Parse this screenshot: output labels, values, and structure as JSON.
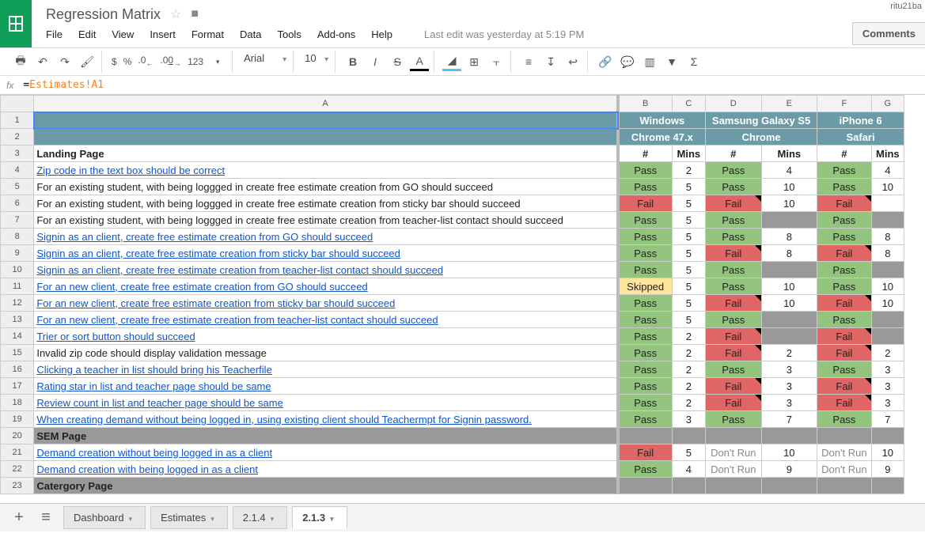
{
  "doc": {
    "title": "Regression Matrix",
    "user": "ritu21ba",
    "last_edit": "Last edit was yesterday at 5:19 PM",
    "comments_btn": "Comments"
  },
  "menubar": [
    "File",
    "Edit",
    "View",
    "Insert",
    "Format",
    "Data",
    "Tools",
    "Add-ons",
    "Help"
  ],
  "toolbar": {
    "currency": "$",
    "percent": "%",
    "dec_dec": ".0←",
    "dec_inc": ".00→",
    "more_fmt": "123",
    "font": "Arial",
    "size": "10"
  },
  "formula": {
    "eq": "=",
    "ref": "Estimates!A1"
  },
  "columns": [
    "",
    "A",
    "B",
    "C",
    "D",
    "E",
    "F",
    "G"
  ],
  "header1": {
    "B": "Windows",
    "D": "Samsung Galaxy S5",
    "F": "iPhone 6"
  },
  "header2": {
    "B": "Chrome 47.x",
    "D": "Chrome",
    "F": "Safari"
  },
  "rows": [
    {
      "n": 1
    },
    {
      "n": 2
    },
    {
      "n": 3,
      "a": "Landing Page",
      "bold": true,
      "b": "#",
      "c": "Mins",
      "d": "#",
      "e": "Mins",
      "f": "#",
      "g": "Mins",
      "hdr": true
    },
    {
      "n": 4,
      "a": "Zip code in the text box should be correct",
      "link": true,
      "b": "Pass",
      "c": "2",
      "d": "Pass",
      "e": "4",
      "f": "Pass",
      "g": "4"
    },
    {
      "n": 5,
      "a": "For an existing student, with being loggged in create free estimate creation from GO should succeed",
      "b": "Pass",
      "c": "5",
      "d": "Pass",
      "e": "10",
      "f": "Pass",
      "g": "10"
    },
    {
      "n": 6,
      "a": "For an existing student, with being loggged in create free estimate creation from sticky bar should succeed",
      "b": "Fail",
      "c": "5",
      "d": "Fail",
      "e": "10",
      "f": "Fail",
      "g": "",
      "note_d": true,
      "note_f": true
    },
    {
      "n": 7,
      "a": "For an existing student, with being loggged in create free estimate creation from teacher-list contact should succeed",
      "b": "Pass",
      "c": "5",
      "d": "Pass",
      "e": "",
      "f": "Pass",
      "g": "",
      "egray": true,
      "ggray": true
    },
    {
      "n": 8,
      "a": "Signin as an client, create free estimate creation from GO should succeed",
      "link": true,
      "b": "Pass",
      "c": "5",
      "d": "Pass",
      "e": "8",
      "f": "Pass",
      "g": "8"
    },
    {
      "n": 9,
      "a": "Signin as an client, create free estimate creation from sticky bar should succeed",
      "link": true,
      "b": "Pass",
      "c": "5",
      "d": "Fail",
      "e": "8",
      "f": "Fail",
      "g": "8",
      "note_d": true,
      "note_f": true
    },
    {
      "n": 10,
      "a": "Signin as an client, create free estimate creation from teacher-list contact should succeed",
      "link": true,
      "b": "Pass",
      "c": "5",
      "d": "Pass",
      "e": "",
      "f": "Pass",
      "g": "",
      "egray": true,
      "ggray": true
    },
    {
      "n": 11,
      "a": "For an new  client, create free estimate creation from GO should succeed",
      "link": true,
      "b": "Skipped",
      "c": "5",
      "d": "Pass",
      "e": "10",
      "f": "Pass",
      "g": "10"
    },
    {
      "n": 12,
      "a": "For an new  client, create free estimate creation from sticky bar should succeed",
      "link": true,
      "b": "Pass",
      "c": "5",
      "d": "Fail",
      "e": "10",
      "f": "Fail",
      "g": "10",
      "note_d": true,
      "note_f": true
    },
    {
      "n": 13,
      "a": "For an new  client, create free estimate creation from teacher-list contact should succeed",
      "link": true,
      "b": "Pass",
      "c": "5",
      "d": "Pass",
      "e": "",
      "f": "Pass",
      "g": "",
      "egray": true,
      "ggray": true
    },
    {
      "n": 14,
      "a": "Trier or sort button should succeed",
      "link": true,
      "b": "Pass",
      "c": "2",
      "d": "Fail",
      "e": "",
      "f": "Fail",
      "g": "",
      "note_d": true,
      "note_f": true,
      "egray": true,
      "ggray": true
    },
    {
      "n": 15,
      "a": "Invalid zip code should display validation message",
      "b": "Pass",
      "c": "2",
      "d": "Fail",
      "e": "2",
      "f": "Fail",
      "g": "2",
      "note_d": true,
      "note_f": true
    },
    {
      "n": 16,
      "a": "Clicking a teacher in list should bring his Teacherfile",
      "link": true,
      "b": "Pass",
      "c": "2",
      "d": "Pass",
      "e": "3",
      "f": "Pass",
      "g": "3"
    },
    {
      "n": 17,
      "a": "Rating star in list and teacher page should be same",
      "link": true,
      "b": "Pass",
      "c": "2",
      "d": "Fail",
      "e": "3",
      "f": "Fail",
      "g": "3",
      "note_d": true,
      "note_f": true
    },
    {
      "n": 18,
      "a": "Review count in list and teacher page should be same",
      "link": true,
      "b": "Pass",
      "c": "2",
      "d": "Fail",
      "e": "3",
      "f": "Fail",
      "g": "3",
      "note_d": true,
      "note_f": true
    },
    {
      "n": 19,
      "a": "When creating demand without being logged in, using existing client should Teachermpt for Signin password.",
      "link": true,
      "b": "Pass",
      "c": "3",
      "d": "Pass",
      "e": "7",
      "f": "Pass",
      "g": "7"
    },
    {
      "n": 20,
      "a": "SEM Page",
      "bold": true,
      "rowgray": true
    },
    {
      "n": 21,
      "a": "Demand creation without being logged in as a client",
      "link": true,
      "b": "Fail",
      "c": "5",
      "d": "Don't Run",
      "e": "10",
      "f": "Don't Run",
      "g": "10"
    },
    {
      "n": 22,
      "a": "Demand creation with being logged in as a client",
      "link": true,
      "b": "Pass",
      "c": "4",
      "d": "Don't Run",
      "e": "9",
      "f": "Don't Run",
      "g": "9"
    },
    {
      "n": 23,
      "a": "Catergory Page",
      "bold": true,
      "rowgray": true
    }
  ],
  "sheets": [
    {
      "name": "Dashboard"
    },
    {
      "name": "Estimates"
    },
    {
      "name": "2.1.4"
    },
    {
      "name": "2.1.3",
      "active": true
    }
  ]
}
